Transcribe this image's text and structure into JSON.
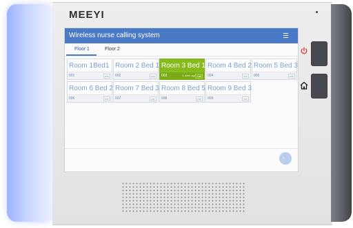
{
  "device": {
    "brand": "MEEYI",
    "colors": {
      "led": "#c9d6ff",
      "power_icon": "#e03b3b"
    }
  },
  "app": {
    "title": "Wireless nurse calling system",
    "menu_icon": "hamburger-menu-icon",
    "colors": {
      "appbar": "#4a79c6",
      "calling": "#86bb1e",
      "bed_text": "#7a9dcf"
    }
  },
  "tabs": [
    {
      "label": "Floor 1",
      "active": true
    },
    {
      "label": "Floor 2",
      "active": false
    }
  ],
  "beds": [
    {
      "name": "Room 1Bed1",
      "number": "001",
      "tag": "idle",
      "calling": false
    },
    {
      "name": "Room 2 Bed 1",
      "number": "002",
      "tag": "idle",
      "calling": false
    },
    {
      "name": "Room 3 Bed 1",
      "number": "003",
      "tag": "Call",
      "time": "1 mins ago",
      "calling": true
    },
    {
      "name": "Room 4 Bed 2",
      "number": "004",
      "tag": "idle",
      "calling": false
    },
    {
      "name": "Room 5 Bed 3",
      "number": "005",
      "tag": "idle",
      "calling": false
    },
    {
      "name": "Room 6 Bed 2",
      "number": "006",
      "tag": "idle",
      "calling": false
    },
    {
      "name": "Room 7 Bed 3",
      "number": "007",
      "tag": "idle",
      "calling": false
    },
    {
      "name": "Room 8 Bed 5",
      "number": "008",
      "tag": "idle",
      "calling": false
    },
    {
      "name": "Room 9 Bed 3",
      "number": "009",
      "tag": "idle",
      "calling": false
    }
  ],
  "hardware": {
    "power_icon": "power-icon",
    "home_icon": "home-icon"
  }
}
